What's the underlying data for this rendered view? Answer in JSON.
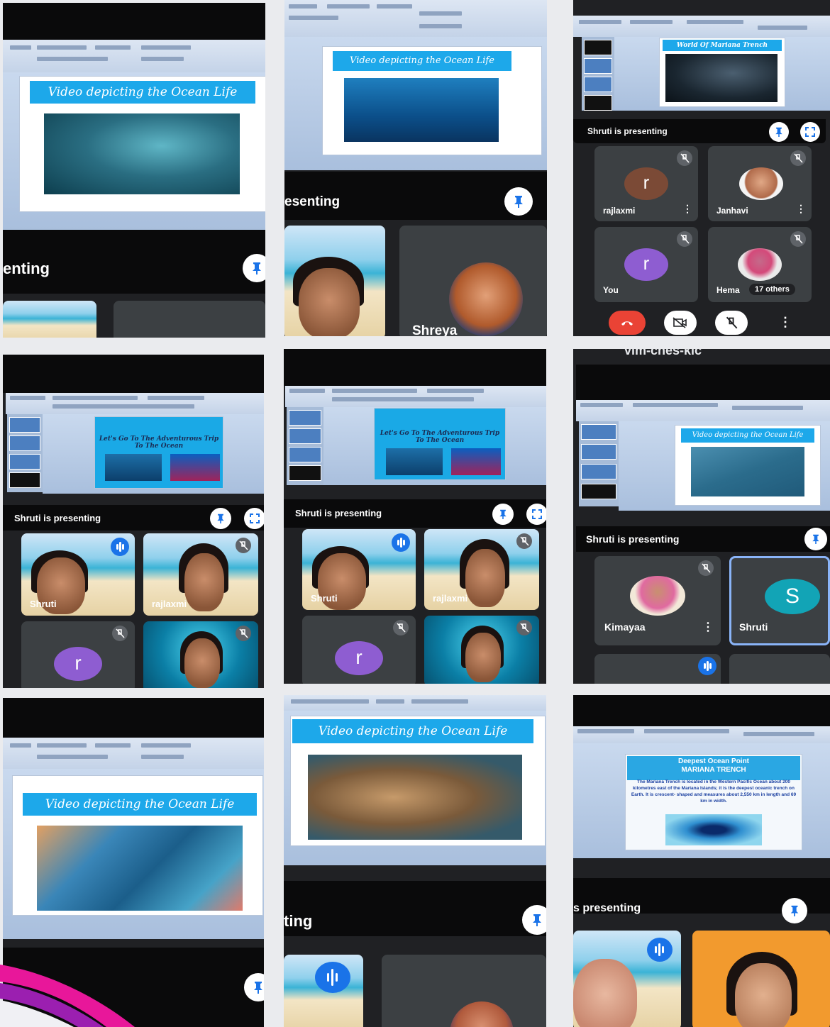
{
  "slides": {
    "ocean_video_title": "Video depicting the Ocean Life",
    "adventure_title": "Let's Go To The Adventurous Trip To The Ocean",
    "mariana_title": "World Of Mariana Trench",
    "deepest_heading_1": "Deepest Ocean Point",
    "deepest_heading_2": "MARIANA TRENCH",
    "deepest_body": "The Mariana Trench is located in the Western Pacific Ocean about 200 kilometres east of the Mariana Islands; it is the deepest oceanic trench on Earth. It is crescent- shaped and measures about 2,550 km in length and 69 km in width."
  },
  "meet": {
    "presenting_full": "Shruti is presenting",
    "presenting_crop_1": "enting",
    "presenting_crop_2": "esenting",
    "presenting_crop_3": "ting",
    "presenting_crop_4": "s presenting",
    "others_count": "17 others",
    "meeting_code_crop": "vlm-ches-kic"
  },
  "participants": {
    "rajlaxmi": "rajlaxmi",
    "janhavi": "Janhavi",
    "you": "You",
    "hema": "Hema",
    "shreya": "Shreya",
    "shruti": "Shruti",
    "kimayaa": "Kimayaa",
    "avatar_r": "r",
    "avatar_s": "S"
  },
  "colors": {
    "meet_bg": "#202124",
    "avatar_brown": "#7b4a36",
    "avatar_purple": "#8e5dd1",
    "avatar_teal": "#12a4b6",
    "banner_blue": "#1da8ea",
    "end_call_red": "#ea4335",
    "speaking_blue": "#1a73e8",
    "accent_pink": "#e8179a"
  },
  "icons": [
    "pin-icon",
    "fullscreen-icon",
    "mic-off-icon",
    "more-vert-icon",
    "speaking-icon",
    "end-call-icon",
    "camera-off-icon"
  ]
}
